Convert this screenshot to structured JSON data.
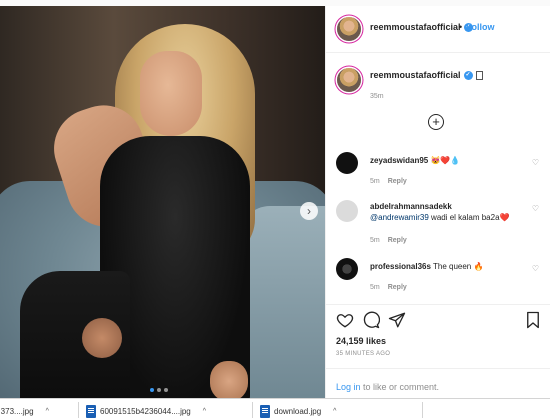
{
  "post": {
    "username": "reemmoustafaofficial",
    "follow_separator": "•",
    "follow_label": "Follow",
    "more_label": "•••",
    "caption_time": "35m",
    "load_more_label": "+",
    "next_arrow": "›",
    "comments": [
      {
        "user": "zeyadswidan95",
        "text": " 😻❤️💧",
        "text2": "",
        "mention": "",
        "time": "5m",
        "reply": "Reply"
      },
      {
        "user": "abdelrahmannsadekk",
        "text": "",
        "mention": "@andrewamir39",
        "text2": " wadi el kalam ba2a❤️",
        "time": "5m",
        "reply": "Reply"
      },
      {
        "user": "professional36s",
        "text": " The queen 🔥",
        "text2": "",
        "mention": "",
        "time": "5m",
        "reply": "Reply"
      }
    ],
    "likes": "24,159 likes",
    "posted": "35 MINUTES AGO",
    "login_link": "Log in",
    "login_rest": " to like or comment."
  },
  "downloads": [
    {
      "name": "...373....jpg",
      "caret": "^"
    },
    {
      "name": "60091515b4236044....jpg",
      "caret": "^"
    },
    {
      "name": "download.jpg",
      "caret": "^"
    }
  ],
  "colors": {
    "accent": "#3897f0",
    "text": "#262626",
    "muted": "#8e8e8e"
  },
  "icons": [
    "heart-icon",
    "comment-icon",
    "share-icon",
    "bookmark-icon",
    "verified-badge-icon",
    "more-options-icon",
    "add-circle-icon",
    "file-icon",
    "chevron-up-icon"
  ]
}
